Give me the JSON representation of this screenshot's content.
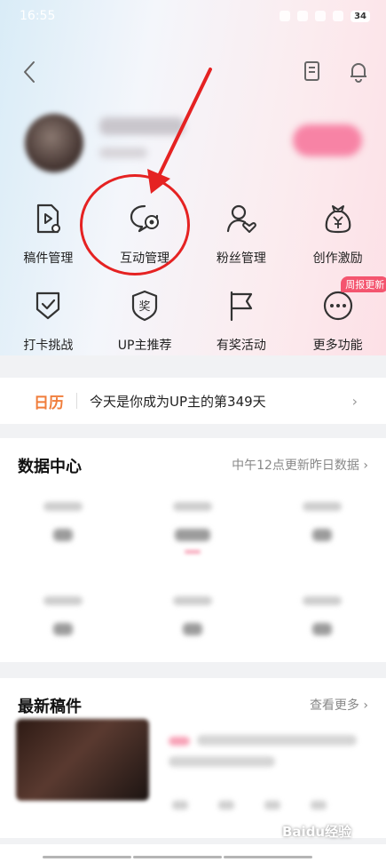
{
  "status_bar": {
    "time": "16:55",
    "battery": "34"
  },
  "grid_row1": [
    {
      "label": "稿件管理",
      "icon": "video-doc-icon"
    },
    {
      "label": "互动管理",
      "icon": "chat-bubble-icon"
    },
    {
      "label": "粉丝管理",
      "icon": "user-heart-icon"
    },
    {
      "label": "创作激励",
      "icon": "money-bag-icon"
    }
  ],
  "grid_row2": [
    {
      "label": "打卡挑战",
      "icon": "check-shield-icon"
    },
    {
      "label": "UP主推荐",
      "icon": "award-badge-icon"
    },
    {
      "label": "有奖活动",
      "icon": "flag-icon"
    },
    {
      "label": "更多功能",
      "icon": "more-dots-icon",
      "badge": "周报更新"
    }
  ],
  "calendar": {
    "tag": "日历",
    "text": "今天是你成为UP主的第349天"
  },
  "data_center": {
    "title": "数据中心",
    "link": "中午12点更新昨日数据"
  },
  "latest": {
    "title": "最新稿件",
    "link": "查看更多"
  },
  "watermark": "Baidu经验",
  "colors": {
    "accent_orange": "#f07d3b",
    "accent_pink": "#f783a5",
    "badge_red": "#f4556f",
    "annotation_red": "#e52222"
  }
}
